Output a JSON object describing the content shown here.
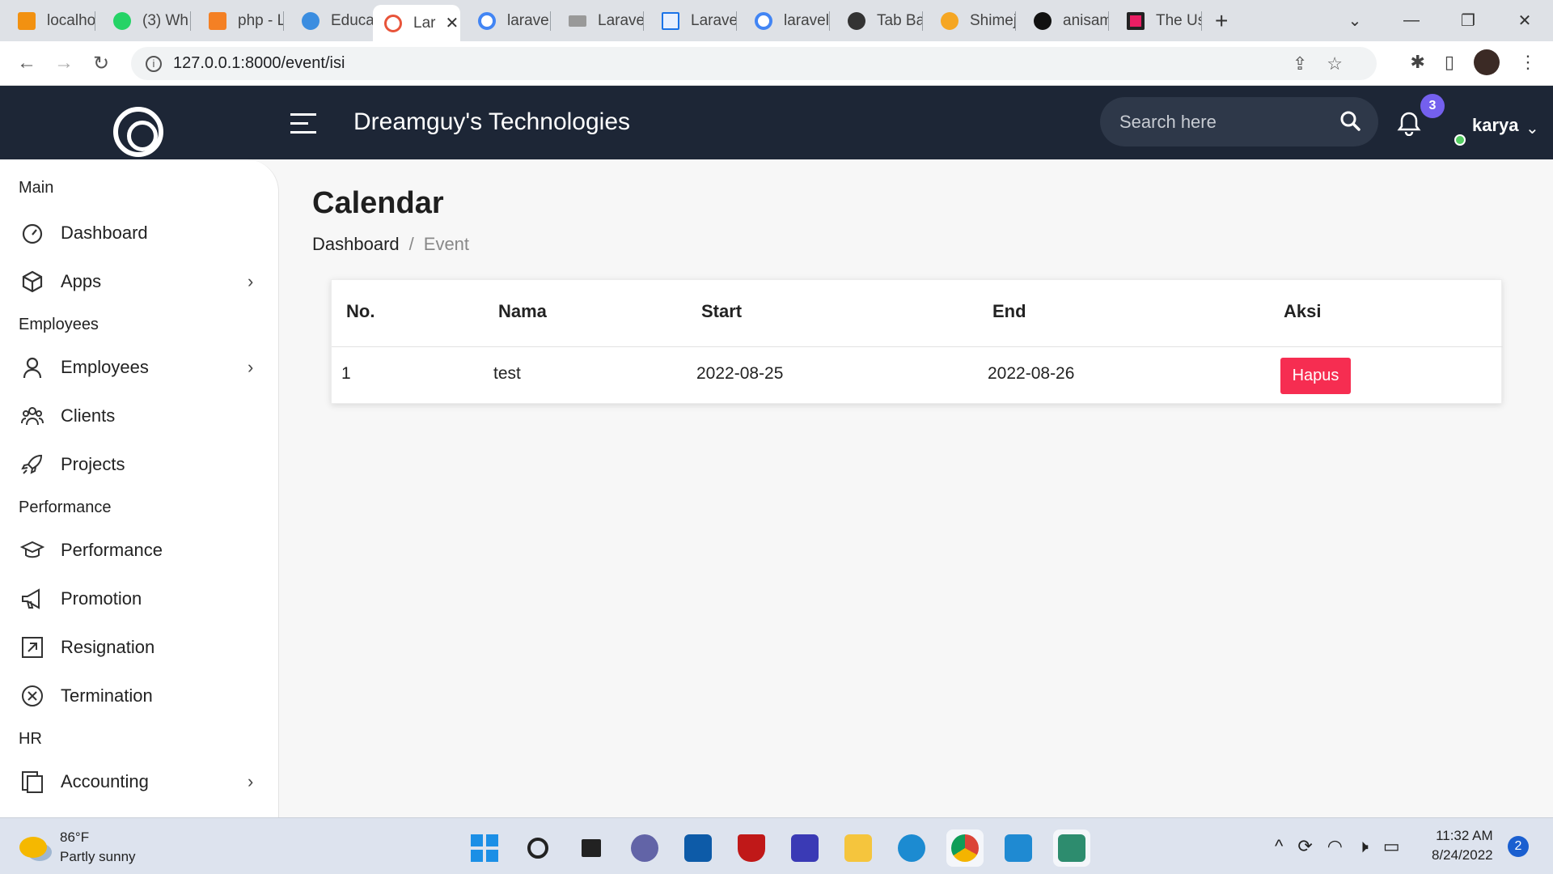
{
  "browser": {
    "tabs": [
      {
        "label": "localho",
        "color": "#f29111",
        "icon": "phpmyadmin-icon"
      },
      {
        "label": "(3) Wh",
        "color": "#25d366",
        "icon": "whatsapp-icon"
      },
      {
        "label": "php - L",
        "color": "#f48024",
        "icon": "stackoverflow-icon"
      },
      {
        "label": "Educa",
        "color": "#3b8de0",
        "icon": "educa-icon"
      },
      {
        "label": "Lar",
        "color": "#e8543a",
        "icon": "laravel-app-icon",
        "active": true
      },
      {
        "label": "laravel",
        "color": "#4285f4",
        "icon": "google-icon"
      },
      {
        "label": "Laravel",
        "color": "#777777",
        "icon": "page-icon"
      },
      {
        "label": "Laravel",
        "color": "#1a73e8",
        "icon": "page-icon"
      },
      {
        "label": "laravel",
        "color": "#4285f4",
        "icon": "google-icon"
      },
      {
        "label": "Tab Ba",
        "color": "#333333",
        "icon": "tabbar-icon"
      },
      {
        "label": "Shimej",
        "color": "#f5a623",
        "icon": "shimeji-icon"
      },
      {
        "label": "anisam",
        "color": "#111111",
        "icon": "github-icon"
      },
      {
        "label": "The Us",
        "color": "#e91e63",
        "icon": "page-icon"
      }
    ],
    "url": "127.0.0.1:8000/event/isi"
  },
  "header": {
    "brand": "Dreamguy's Technologies",
    "search_placeholder": "Search here",
    "notification_count": "3",
    "username": "karya"
  },
  "sidebar": {
    "sections": {
      "main": "Main",
      "employees": "Employees",
      "performance": "Performance",
      "hr": "HR"
    },
    "items": {
      "dashboard": "Dashboard",
      "apps": "Apps",
      "employees": "Employees",
      "clients": "Clients",
      "projects": "Projects",
      "performance": "Performance",
      "promotion": "Promotion",
      "resignation": "Resignation",
      "termination": "Termination",
      "accounting": "Accounting"
    }
  },
  "page": {
    "title": "Calendar",
    "breadcrumb": [
      "Dashboard",
      "Event"
    ],
    "table": {
      "headers": [
        "No.",
        "Nama",
        "Start",
        "End",
        "Aksi"
      ],
      "rows": [
        {
          "no": "1",
          "nama": "test",
          "start": "2022-08-25",
          "end": "2022-08-26",
          "action": "Hapus"
        }
      ]
    }
  },
  "taskbar": {
    "weather": {
      "temp": "86°F",
      "desc": "Partly sunny"
    },
    "time": "11:32 AM",
    "date": "8/24/2022",
    "notifications": "2"
  },
  "colors": {
    "header_bg": "#1d2636",
    "badge": "#7460ee",
    "danger": "#f62d51",
    "online": "#55ce63"
  }
}
